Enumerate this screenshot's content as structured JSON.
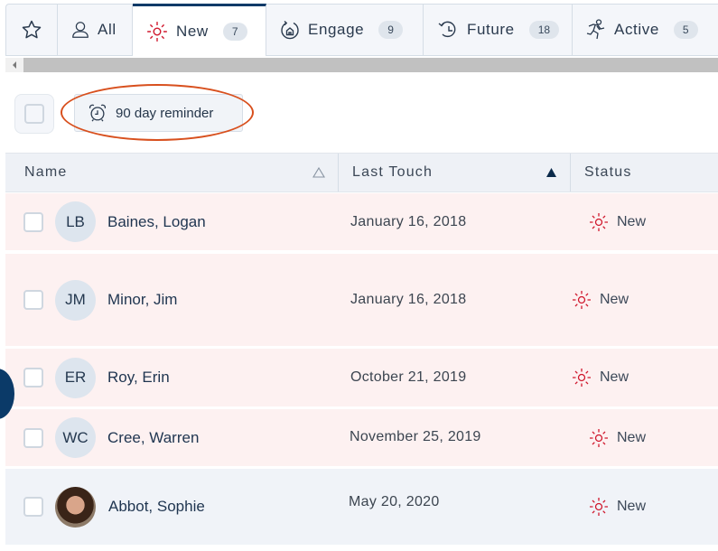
{
  "tabs": [
    {
      "id": "favorites",
      "label": "",
      "icon": "star-icon"
    },
    {
      "id": "all",
      "label": "All",
      "icon": "person-icon"
    },
    {
      "id": "new",
      "label": "New",
      "icon": "sun-icon",
      "count": "7",
      "selected": true
    },
    {
      "id": "engage",
      "label": "Engage",
      "icon": "home-cycle-icon",
      "count": "9"
    },
    {
      "id": "future",
      "label": "Future",
      "icon": "history-clock-icon",
      "count": "18"
    },
    {
      "id": "active",
      "label": "Active",
      "icon": "runner-icon",
      "count": "5"
    }
  ],
  "toolbar": {
    "reminder_label": "90 day reminder",
    "reminder_icon": "alarm-clock-icon"
  },
  "colors": {
    "accent": "#0b3a68",
    "new_status": "#d0192e",
    "highlight_ring": "#d8501e",
    "row_new_bg": "#fdf1f1",
    "row_default_bg": "#f0f3f8"
  },
  "table": {
    "columns": [
      {
        "label": "Name",
        "sort": "none"
      },
      {
        "label": "Last Touch",
        "sort": "ascending"
      },
      {
        "label": "Status"
      }
    ],
    "rows": [
      {
        "initials": "LB",
        "name": "Baines, Logan",
        "last_touch": "January 16, 2018",
        "status": "New"
      },
      {
        "initials": "JM",
        "name": "Minor, Jim",
        "last_touch": "January 16, 2018",
        "status": "New"
      },
      {
        "initials": "ER",
        "name": "Roy, Erin",
        "last_touch": "October 21, 2019",
        "status": "New"
      },
      {
        "initials": "WC",
        "name": "Cree, Warren",
        "last_touch": "November 25, 2019",
        "status": "New"
      },
      {
        "initials": "",
        "name": "Abbot, Sophie",
        "last_touch": "May 20, 2020",
        "status": "New",
        "has_photo": true
      }
    ]
  }
}
